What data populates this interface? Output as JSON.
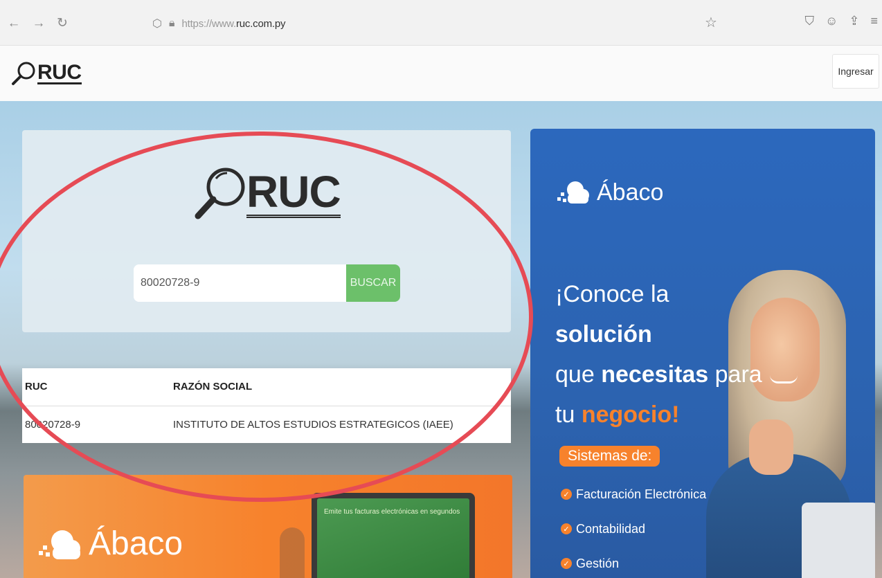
{
  "browser": {
    "url_prefix": "https://www.",
    "url_domain": "ruc.com.py"
  },
  "header": {
    "logo_text": "RUC",
    "login_label": "Ingresar"
  },
  "search": {
    "logo_text": "RUC",
    "value": "80020728-9",
    "button_label": "BUSCAR"
  },
  "results": {
    "columns": [
      "RUC",
      "RAZÓN SOCIAL"
    ],
    "rows": [
      {
        "ruc": "80020728-9",
        "razon_social": "INSTITUTO DE ALTOS ESTUDIOS ESTRATEGICOS (IAEE)"
      }
    ]
  },
  "ad_orange": {
    "brand": "Ábaco",
    "screen_text": "Emite tus facturas electrónicas en segundos"
  },
  "ad_blue": {
    "brand": "Ábaco",
    "headline_1": "¡Conoce la ",
    "headline_1b": "solución",
    "headline_2": "que ",
    "headline_2b": "necesitas",
    "headline_2c": " para",
    "headline_3": "tu ",
    "headline_3b": "negocio!",
    "pill": "Sistemas de:",
    "features": [
      "Facturación Electrónica",
      "Contabilidad",
      "Gestión"
    ]
  },
  "colors": {
    "accent_green": "#6cc06a",
    "accent_orange": "#f7822c",
    "ad_blue": "#2c68bd",
    "annotation_red": "#e64b55"
  }
}
